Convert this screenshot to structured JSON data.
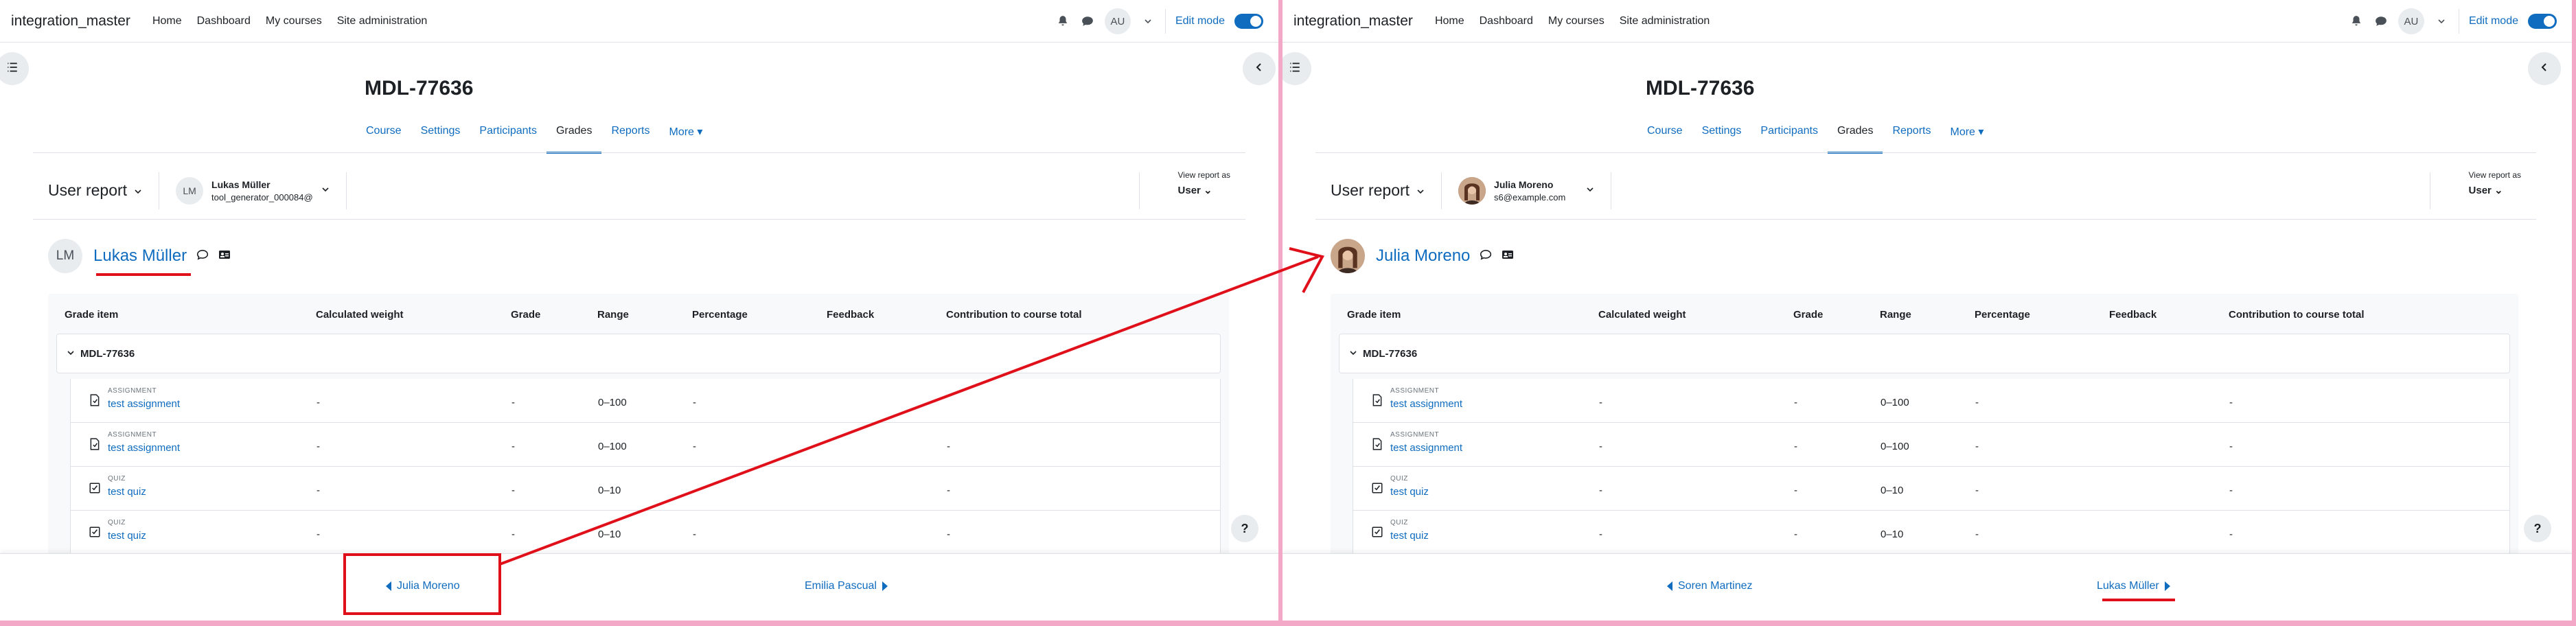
{
  "colors": {
    "link": "#0f6cbf",
    "annotation": "#e0101b",
    "divider": "#f4a8c7"
  },
  "left": {
    "site_name": "integration_master",
    "nav": [
      "Home",
      "Dashboard",
      "My courses",
      "Site administration"
    ],
    "user_initials": "AU",
    "edit_mode": "Edit mode",
    "course_title": "MDL-77636",
    "tabs": [
      "Course",
      "Settings",
      "Participants",
      "Grades",
      "Reports",
      "More"
    ],
    "report": "User report",
    "selected_user": {
      "initials": "LM",
      "name": "Lukas Müller",
      "email": "tool_generator_000084@"
    },
    "view_as_label": "View report as",
    "view_as_value": "User",
    "heading_name": "Lukas Müller",
    "columns": [
      "Grade item",
      "Calculated weight",
      "Grade",
      "Range",
      "Percentage",
      "Feedback",
      "Contribution to course total"
    ],
    "category": "MDL-77636",
    "items": [
      {
        "type": "ASSIGNMENT",
        "name": "test assignment",
        "weight": "-",
        "grade": "-",
        "range": "0–100",
        "percentage": "-",
        "contribution": ""
      },
      {
        "type": "ASSIGNMENT",
        "name": "test assignment",
        "weight": "-",
        "grade": "-",
        "range": "0–100",
        "percentage": "-",
        "contribution": "-"
      },
      {
        "type": "QUIZ",
        "name": "test quiz",
        "weight": "-",
        "grade": "-",
        "range": "0–10",
        "percentage": "",
        "contribution": "-"
      },
      {
        "type": "QUIZ",
        "name": "test quiz",
        "weight": "-",
        "grade": "-",
        "range": "0–10",
        "percentage": "-",
        "contribution": "-"
      }
    ],
    "help": "?",
    "prev_user": "Julia Moreno",
    "next_user": "Emilia Pascual"
  },
  "right": {
    "site_name": "integration_master",
    "nav": [
      "Home",
      "Dashboard",
      "My courses",
      "Site administration"
    ],
    "user_initials": "AU",
    "edit_mode": "Edit mode",
    "course_title": "MDL-77636",
    "tabs": [
      "Course",
      "Settings",
      "Participants",
      "Grades",
      "Reports",
      "More"
    ],
    "report": "User report",
    "selected_user": {
      "name": "Julia Moreno",
      "email": "s6@example.com"
    },
    "view_as_label": "View report as",
    "view_as_value": "User",
    "heading_name": "Julia Moreno",
    "columns": [
      "Grade item",
      "Calculated weight",
      "Grade",
      "Range",
      "Percentage",
      "Feedback",
      "Contribution to course total"
    ],
    "category": "MDL-77636",
    "items": [
      {
        "type": "ASSIGNMENT",
        "name": "test assignment",
        "weight": "-",
        "grade": "-",
        "range": "0–100",
        "percentage": "-",
        "contribution": "-"
      },
      {
        "type": "ASSIGNMENT",
        "name": "test assignment",
        "weight": "-",
        "grade": "-",
        "range": "0–100",
        "percentage": "-",
        "contribution": "-"
      },
      {
        "type": "QUIZ",
        "name": "test quiz",
        "weight": "-",
        "grade": "-",
        "range": "0–10",
        "percentage": "-",
        "contribution": "-"
      },
      {
        "type": "QUIZ",
        "name": "test quiz",
        "weight": "-",
        "grade": "-",
        "range": "0–10",
        "percentage": "-",
        "contribution": "-"
      }
    ],
    "help": "?",
    "prev_user": "Soren Martinez",
    "next_user": "Lukas Müller"
  }
}
